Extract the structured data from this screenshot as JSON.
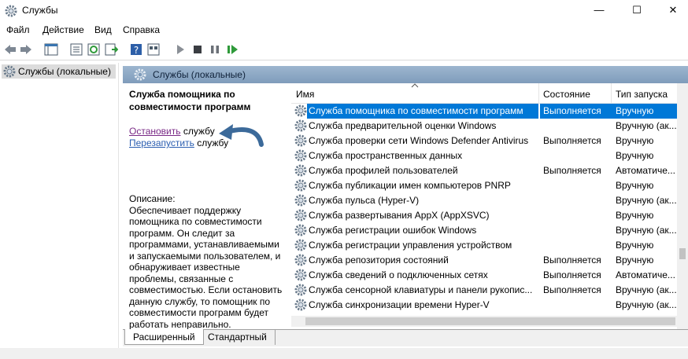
{
  "window": {
    "title": "Службы",
    "minimize": "—",
    "maximize": "☐",
    "close": "✕"
  },
  "menu": [
    "Файл",
    "Действие",
    "Вид",
    "Справка"
  ],
  "tree": {
    "root_label": "Службы (локальные)"
  },
  "panel": {
    "header": "Службы (локальные)",
    "selected_service": "Служба помощника по совместимости программ",
    "stop_link": "Остановить",
    "stop_suffix": " службу",
    "restart_link": "Перезапустить",
    "restart_suffix": " службу",
    "description_label": "Описание:",
    "description": "Обеспечивает поддержку помощника по совместимости программ. Он следит за программами, устанавливаемыми и запускаемыми пользователем, и обнаруживает известные проблемы, связанные с совместимостью. Если остановить данную службу, то помощник по совместимости программ будет работать неправильно."
  },
  "columns": {
    "name": "Имя",
    "status": "Состояние",
    "startup": "Тип запуска"
  },
  "services": [
    {
      "name": "Служба помощника по совместимости программ",
      "status": "Выполняется",
      "startup": "Вручную"
    },
    {
      "name": "Служба предварительной оценки Windows",
      "status": "",
      "startup": "Вручную (ак..."
    },
    {
      "name": "Служба проверки сети Windows Defender Antivirus",
      "status": "Выполняется",
      "startup": "Вручную"
    },
    {
      "name": "Служба пространственных данных",
      "status": "",
      "startup": "Вручную"
    },
    {
      "name": "Служба профилей пользователей",
      "status": "Выполняется",
      "startup": "Автоматиче..."
    },
    {
      "name": "Служба публикации имен компьютеров PNRP",
      "status": "",
      "startup": "Вручную"
    },
    {
      "name": "Служба пульса (Hyper-V)",
      "status": "",
      "startup": "Вручную (ак..."
    },
    {
      "name": "Служба развертывания AppX (AppXSVC)",
      "status": "",
      "startup": "Вручную"
    },
    {
      "name": "Служба регистрации ошибок Windows",
      "status": "",
      "startup": "Вручную (ак..."
    },
    {
      "name": "Служба регистрации управления устройством",
      "status": "",
      "startup": "Вручную"
    },
    {
      "name": "Служба репозитория состояний",
      "status": "Выполняется",
      "startup": "Вручную"
    },
    {
      "name": "Служба сведений о подключенных сетях",
      "status": "Выполняется",
      "startup": "Автоматиче..."
    },
    {
      "name": "Служба сенсорной клавиатуры и панели рукопис...",
      "status": "Выполняется",
      "startup": "Вручную (ак..."
    },
    {
      "name": "Служба синхронизации времени Hyper-V",
      "status": "",
      "startup": "Вручную (ак..."
    }
  ],
  "tabs": {
    "extended": "Расширенный",
    "standard": "Стандартный"
  },
  "colors": {
    "selection": "#0078d7",
    "panel_header": "#9db6cf",
    "link": "#2a5db0",
    "arrow": "#3c6a9a"
  }
}
